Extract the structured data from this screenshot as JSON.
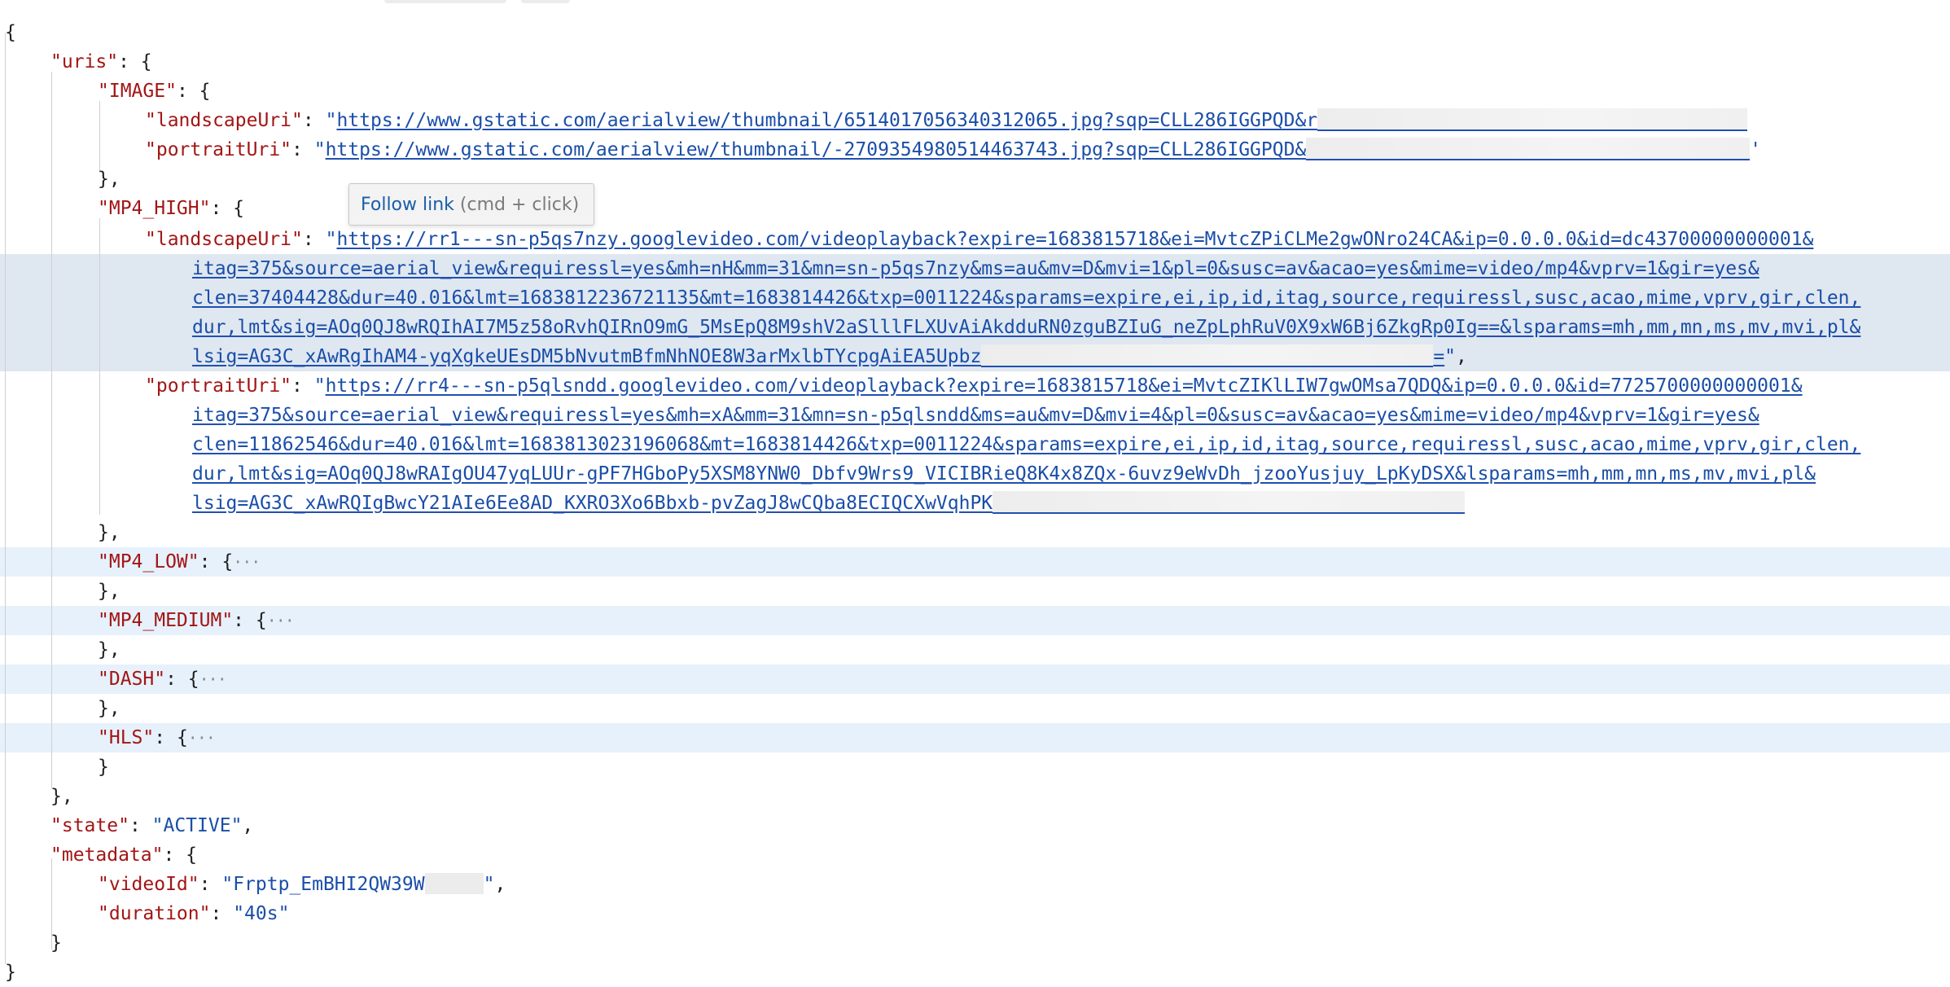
{
  "json_view": {
    "open_root": "{",
    "close_root": "}",
    "uris_key": "\"uris\"",
    "image_key": "\"IMAGE\"",
    "image_landscape_key": "\"landscapeUri\"",
    "image_landscape_url": "https://www.gstatic.com/aerialview/thumbnail/6514017056340312065.jpg?sqp=CLL286IGGPQD&r",
    "image_portrait_key": "\"portraitUri\"",
    "image_portrait_url": "https://www.gstatic.com/aerialview/thumbnail/-2709354980514463743.jpg?sqp=CLL286IGGPQD&",
    "mp4_high_key": "\"MP4_HIGH\"",
    "high_landscape_key": "\"landscapeUri\"",
    "high_landscape_url_1": "https://rr1---sn-p5qs7nzy.googlevideo.com/videoplayback?expire=1683815718&ei=MvtcZPiCLMe2gwONro24CA&ip=0.0.0.0&id=dc43700000000001&",
    "high_landscape_url_2": "itag=375&source=aerial_view&requiressl=yes&mh=nH&mm=31&mn=sn-p5qs7nzy&ms=au&mv=D&mvi=1&pl=0&susc=av&acao=yes&mime=video/mp4&vprv=1&gir=yes&",
    "high_landscape_url_3": "clen=37404428&dur=40.016&lmt=1683812236721135&mt=1683814426&txp=0011224&sparams=expire,ei,ip,id,itag,source,requiressl,susc,acao,mime,vprv,gir,clen,",
    "high_landscape_url_4": "dur,lmt&sig=AOq0QJ8wRQIhAI7M5z58oRvhQIRnO9mG_5MsEpQ8M9shV2aSlllFLXUvAiAkdduRN0zguBZIuG_neZpLphRuV0X9xW6Bj6ZkgRp0Ig==&lsparams=mh,mm,mn,ms,mv,mvi,pl&",
    "high_landscape_url_5": "lsig=AG3C_xAwRgIhAM4-yqXgkeUEsDM5bNvutmBfmNhNOE8W3arMxlbTYcpgAiEA5Upbz",
    "high_landscape_url_tail": "=",
    "high_portrait_key": "\"portraitUri\"",
    "high_portrait_url_1": "https://rr4---sn-p5qlsndd.googlevideo.com/videoplayback?expire=1683815718&ei=MvtcZIKlLIW7gwOMsa7QDQ&ip=0.0.0.0&id=7725700000000001&",
    "high_portrait_url_2": "itag=375&source=aerial_view&requiressl=yes&mh=xA&mm=31&mn=sn-p5qlsndd&ms=au&mv=D&mvi=4&pl=0&susc=av&acao=yes&mime=video/mp4&vprv=1&gir=yes&",
    "high_portrait_url_3": "clen=11862546&dur=40.016&lmt=1683813023196068&mt=1683814426&txp=0011224&sparams=expire,ei,ip,id,itag,source,requiressl,susc,acao,mime,vprv,gir,clen,",
    "high_portrait_url_4": "dur,lmt&sig=AOq0QJ8wRAIgOU47yqLUUr-gPF7HGboPy5XSM8YNW0_Dbfv9Wrs9_VICIBRieQ8K4x8ZQx-6uvz9eWvDh_jzooYusjuy_LpKyDSX&lsparams=mh,mm,mn,ms,mv,mvi,pl&",
    "high_portrait_url_5": "lsig=AG3C_xAwRQIgBwcY21AIe6Ee8AD_KXRO3Xo6Bbxb-pvZagJ8wCQba8ECIQCXwVqhPK",
    "mp4_low_key": "\"MP4_LOW\"",
    "mp4_medium_key": "\"MP4_MEDIUM\"",
    "dash_key": "\"DASH\"",
    "hls_key": "\"HLS\"",
    "state_key": "\"state\"",
    "state_value": "\"ACTIVE\"",
    "metadata_key": "\"metadata\"",
    "video_id_key": "\"videoId\"",
    "video_id_value": "\"Frptp_EmBHI2QW39W",
    "duration_key": "\"duration\"",
    "duration_value": "\"40s\""
  },
  "tooltip": {
    "link_text": "Follow link",
    "hint_text": "(cmd + click)"
  }
}
